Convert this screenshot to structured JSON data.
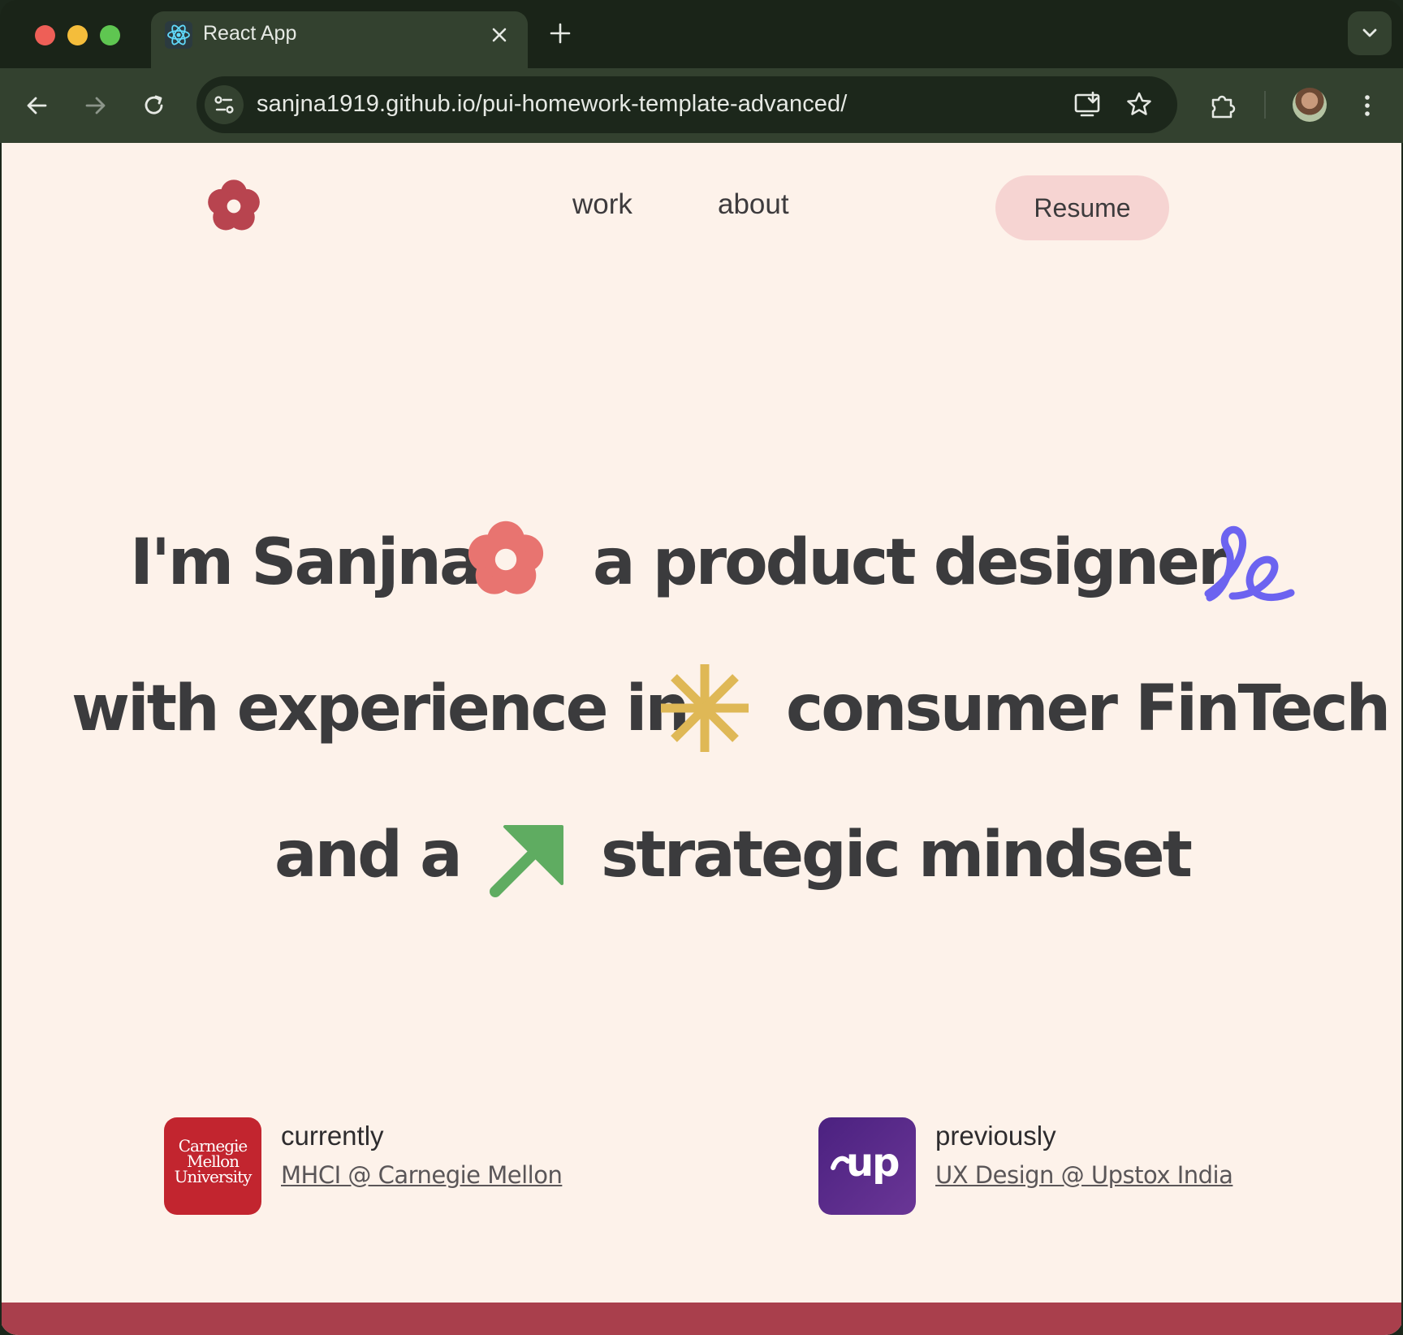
{
  "browser": {
    "tab_title": "React App",
    "url": "sanjna1919.github.io/pui-homework-template-advanced/",
    "icons": [
      "back-arrow",
      "forward-arrow",
      "reload",
      "site-settings",
      "install-app",
      "bookmark-star",
      "extensions-puzzle",
      "profile-avatar",
      "kebab-menu"
    ]
  },
  "nav": {
    "links": [
      {
        "label": "work"
      },
      {
        "label": "about"
      }
    ],
    "resume_label": "Resume"
  },
  "hero": {
    "line1_a": "I'm Sanjna",
    "line1_b": "a product designer",
    "line2_a": "with experience in",
    "line2_b": "consumer FinTech",
    "line3_a": "and a",
    "line3_b": "strategic mindset"
  },
  "experience": {
    "current": {
      "label": "currently",
      "link": "MHCI @ Carnegie Mellon",
      "logo_lines": [
        "Carnegie",
        "Mellon",
        "University"
      ]
    },
    "previous": {
      "label": "previously",
      "link": "UX Design @ Upstox India",
      "logo_text": "up"
    }
  },
  "colors": {
    "page_bg": "#fdf2ea",
    "logo_flower": "#b8444f",
    "hero_flower": "#e87470",
    "squiggle": "#6c63f0",
    "asterisk": "#dfb856",
    "arrow": "#5fac61",
    "resume_bg": "#f6d4d2",
    "cmu_red": "#c2252f",
    "upstox_purple": "#5a2c8a",
    "footer": "#a93f4c"
  }
}
